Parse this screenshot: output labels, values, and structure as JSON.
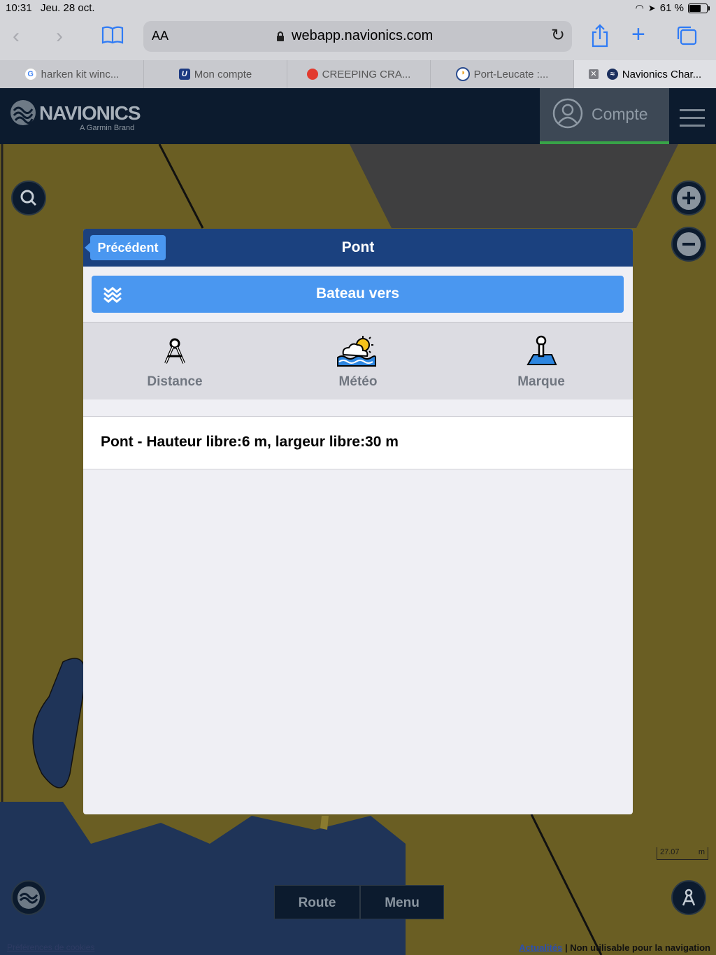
{
  "status_bar": {
    "time": "10:31",
    "date": "Jeu. 28 oct.",
    "battery": "61 %",
    "battery_level": 0.61
  },
  "browser": {
    "text_size_label": "AA",
    "url": "webapp.navionics.com",
    "tabs": [
      {
        "label": "harken kit winc...",
        "favicon": "google-icon"
      },
      {
        "label": "Mon compte",
        "favicon": "u-logo-icon"
      },
      {
        "label": "CREEPING CRA...",
        "favicon": "red-pin-icon"
      },
      {
        "label": "Port-Leucate :...",
        "favicon": "port-icon"
      },
      {
        "label": "Navionics Char...",
        "favicon": "navionics-icon"
      }
    ]
  },
  "app": {
    "logo_word": "NAVIONICS",
    "logo_sub": "A Garmin Brand",
    "account_label": "Compte"
  },
  "modal": {
    "back_label": "Précédent",
    "title": "Pont",
    "boat_to_label": "Bateau vers",
    "actions": [
      {
        "label": "Distance",
        "icon": "compass-divider-icon"
      },
      {
        "label": "Météo",
        "icon": "weather-icon"
      },
      {
        "label": "Marque",
        "icon": "marker-icon"
      }
    ],
    "info_text": "Pont - Hauteur libre:6 m, largeur libre:30 m"
  },
  "map": {
    "route_label": "Route",
    "menu_label": "Menu",
    "scale_value": "27.07",
    "scale_unit": "m",
    "cookie_prefs": "Préférences de cookies",
    "news_link": "Actualités",
    "disclaimer": "| Non utilisable pour la navigation"
  },
  "colors": {
    "accent": "#4a97f0",
    "header": "#1b417f",
    "dark": "#0c1b2e",
    "land": "#6a5e23",
    "sea": "#1f3458"
  }
}
